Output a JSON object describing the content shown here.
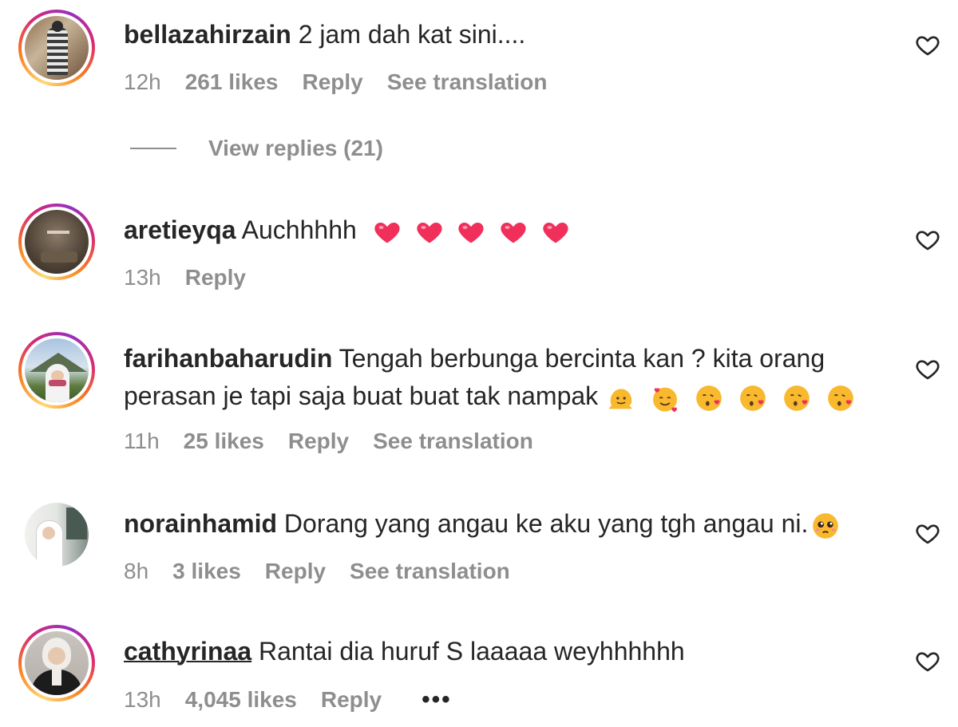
{
  "comments": [
    {
      "username": "bellazahirzain",
      "text": "2 jam dah kat sini....",
      "time": "12h",
      "likes": "261 likes",
      "reply": "Reply",
      "translation": "See translation",
      "view_replies": "View replies (21)"
    },
    {
      "username": "aretieyqa",
      "text": "Auchhhhh",
      "emojis": [
        "heart",
        "heart",
        "heart",
        "heart",
        "heart"
      ],
      "time": "13h",
      "reply": "Reply"
    },
    {
      "username": "farihanbaharudin",
      "text_line1": "Tengah berbunga bercinta kan ? kita orang",
      "text_line2": "perasan je tapi saja buat buat tak nampak",
      "emojis": [
        "melting-face",
        "smiling-face-with-hearts",
        "face-blowing-kiss",
        "face-blowing-kiss",
        "face-blowing-kiss",
        "face-blowing-kiss"
      ],
      "time": "11h",
      "likes": "25 likes",
      "reply": "Reply",
      "translation": "See translation"
    },
    {
      "username": "norainhamid",
      "text": "Dorang yang angau ke aku yang tgh angau ni.",
      "emojis": [
        "pleading-face"
      ],
      "time": "8h",
      "likes": "3 likes",
      "reply": "Reply",
      "translation": "See translation"
    },
    {
      "username": "cathyrinaa",
      "text": "Rantai dia huruf S laaaaa weyhhhhhh",
      "time": "13h",
      "likes": "4,045 likes",
      "reply": "Reply",
      "more": "•••"
    }
  ],
  "icons": {
    "like": "heart-outline-icon",
    "emoji_heart": "red-heart-emoji"
  },
  "colors": {
    "text": "#262626",
    "meta": "#8e8e8e",
    "heart_emoji": "#f0305a",
    "emoji_yellow": "#f9b92e"
  }
}
